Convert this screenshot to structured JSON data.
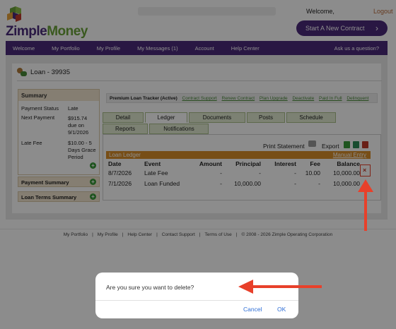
{
  "header": {
    "brand_zimple": "Zimple",
    "brand_money": "Money",
    "welcome": "Welcome,",
    "logout": "Logout",
    "cta_label": "Start A New Contract",
    "cta_chevron": "›"
  },
  "nav": {
    "items": [
      "Welcome",
      "My Portfolio",
      "My Profile",
      "My Messages (1)",
      "Account",
      "Help Center"
    ],
    "ask": "Ask us a question?"
  },
  "loan": {
    "title": "Loan - 39935"
  },
  "summary": {
    "heading": "Summary",
    "status_label": "Payment Status",
    "status_value": "Late",
    "next_label": "Next Payment",
    "next_value_1": "$915.74",
    "next_value_2": "due on",
    "next_value_3": "9/1/2026",
    "fee_label": "Late Fee",
    "fee_value_1": "$10.00 - 5",
    "fee_value_2": "Days Grace",
    "fee_value_3": "Period",
    "payment_summary": "Payment Summary",
    "loan_terms_summary": "Loan Terms Summary",
    "plus": "+"
  },
  "tracker": {
    "title": "Premium Loan Tracker (Active)",
    "links": [
      "Contract Support",
      "Renew Contract",
      "Plan Upgrade",
      "Deactivate",
      "Paid In Full",
      "Delinquent"
    ]
  },
  "tabs": {
    "row1": [
      "Detail",
      "Ledger",
      "Documents",
      "Posts",
      "Schedule"
    ],
    "row2": [
      "Reports",
      "Notifications"
    ]
  },
  "ledger": {
    "print": "Print Statement",
    "export": "Export",
    "bar_title": "Loan Ledger",
    "manual_entry": "Manual Entry",
    "columns": [
      "Date",
      "Event",
      "Amount",
      "Principal",
      "Interest",
      "Fee",
      "Balance"
    ],
    "rows": [
      [
        "8/7/2026",
        "Late Fee",
        "-",
        "-",
        "-",
        "10.00",
        "10,000.00"
      ],
      [
        "7/1/2026",
        "Loan Funded",
        "-",
        "10,000.00",
        "-",
        "-",
        "10,000.00"
      ]
    ],
    "delete_glyph": "×"
  },
  "footer": {
    "links": [
      "My Portfolio",
      "My Profile",
      "Help Center",
      "Contact Support",
      "Terms of Use"
    ],
    "copyright": "© 2008 - 2026 Zimple Operating Corporation",
    "separator": "|"
  },
  "dialog": {
    "message": "Are you sure you want to delete?",
    "cancel": "Cancel",
    "ok": "OK"
  },
  "colors": {
    "brand_purple": "#4b2a7b",
    "brand_green": "#6aa23a",
    "ledger_orange": "#d98f2a",
    "annotation_red": "#e8402a",
    "link_blue": "#2f6fd6"
  }
}
